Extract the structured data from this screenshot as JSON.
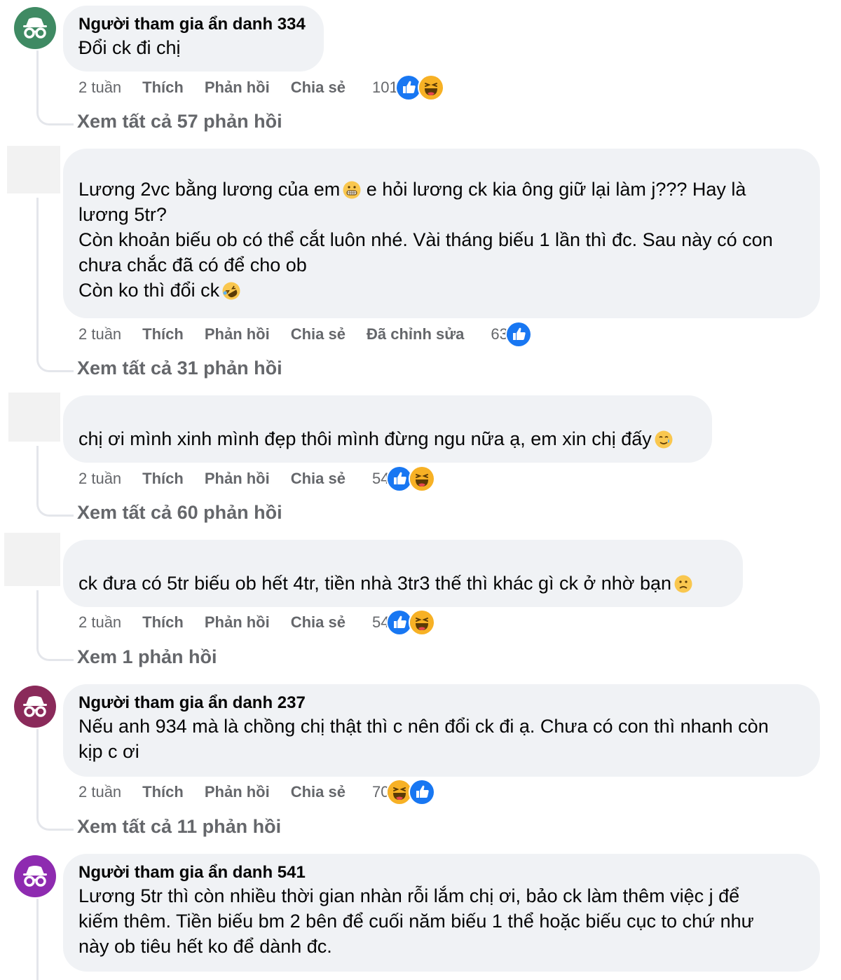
{
  "labels": {
    "like": "Thích",
    "reply": "Phản hồi",
    "share": "Chia sẻ",
    "edited": "Đã chỉnh sửa"
  },
  "colors": {
    "bubble": "#f0f2f5",
    "meta": "#65676b",
    "like_blue": "#1877f2",
    "haha_yellow": "#f7b125"
  },
  "comments": [
    {
      "author": "Người tham gia ẩn danh 334",
      "avatar_color": "#3f8a63",
      "text": "Đổi ck đi chị",
      "time": "2 tuần",
      "reaction_count": "101",
      "reactions": [
        "like-icon",
        "haha-icon"
      ],
      "view_replies": "Xem tất cả 57 phản hồi"
    },
    {
      "author": "",
      "text": "Lương 2vc bằng lương của em",
      "text2": " e hỏi lương ck kia ông giữ lại làm j??? Hay là\nlương 5tr?\nCòn khoản biếu ob có thể cắt luôn nhé. Vài tháng biếu 1 lần thì đc. Sau này có con\nchưa chắc đã có để cho ob\nCòn ko thì đổi ck",
      "time": "2 tuần",
      "reaction_count": "63",
      "reactions": [
        "like-icon"
      ],
      "view_replies": "Xem tất cả 31 phản hồi"
    },
    {
      "author": "",
      "text": "chị ơi mình xinh mình đẹp thôi mình đừng ngu nữa ạ, em xin chị đấy",
      "time": "2 tuần",
      "reaction_count": "54",
      "reactions": [
        "like-icon",
        "haha-icon"
      ],
      "view_replies": "Xem tất cả 60 phản hồi"
    },
    {
      "author": "",
      "text": "ck đưa có 5tr biếu ob hết 4tr, tiền nhà 3tr3 thế thì khác gì ck ở nhờ bạn",
      "time": "2 tuần",
      "reaction_count": "54",
      "reactions": [
        "like-icon",
        "haha-icon"
      ],
      "view_replies": "Xem 1 phản hồi"
    },
    {
      "author": "Người tham gia ẩn danh 237",
      "avatar_color": "#8a2a5a",
      "text": "Nếu anh 934 mà là chồng chị thật thì c nên đổi ck đi ạ. Chưa có con thì nhanh còn\nkịp c ơi",
      "time": "2 tuần",
      "reaction_count": "70",
      "reactions": [
        "haha-icon",
        "like-icon"
      ],
      "view_replies": "Xem tất cả 11 phản hồi"
    },
    {
      "author": "Người tham gia ẩn danh 541",
      "avatar_color": "#8e2bb0",
      "text": "Lương 5tr thì còn nhiều thời gian nhàn rỗi lắm chị ơi, bảo ck làm thêm việc j để\nkiếm thêm. Tiền biếu bm 2 bên để cuối năm biếu 1 thể hoặc biếu cục to chứ như\nnày ob tiêu hết ko để dành đc."
    }
  ]
}
